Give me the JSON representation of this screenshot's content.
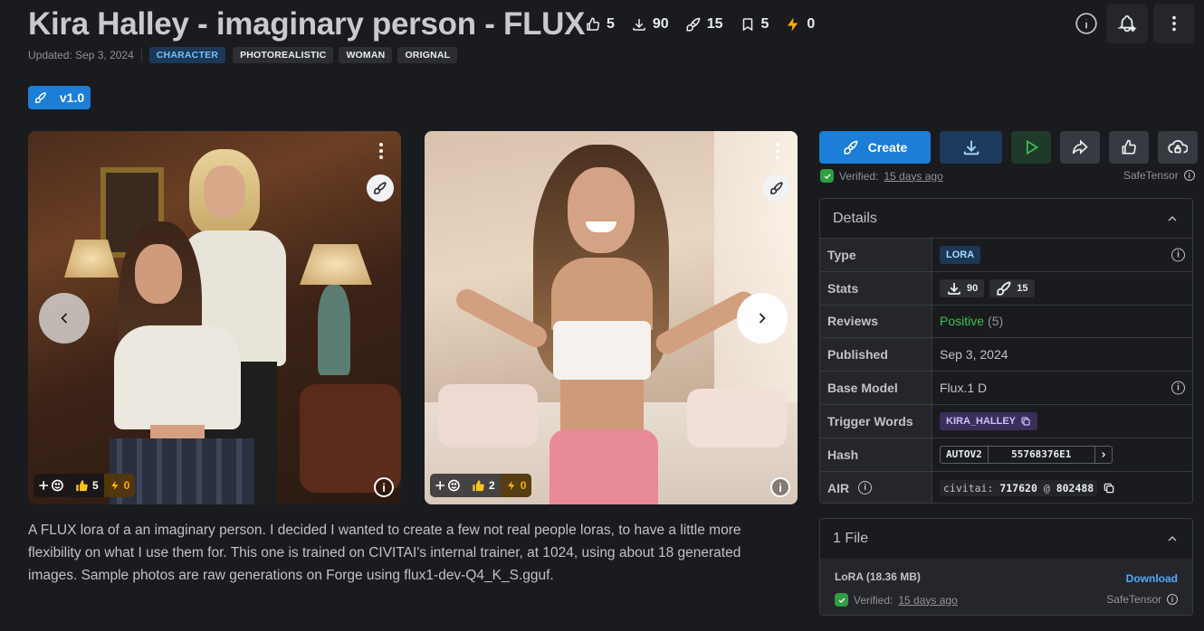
{
  "title": "Kira Halley - imaginary person - FLUX",
  "stats": {
    "likes": "5",
    "downloads": "90",
    "generations": "15",
    "bookmarks": "5",
    "buzz": "0"
  },
  "meta": {
    "updated": "Updated: Sep 3, 2024",
    "tags": [
      "CHARACTER",
      "PHOTOREALISTIC",
      "WOMAN",
      "ORIGNAL"
    ]
  },
  "version": {
    "label": "v1.0"
  },
  "images": [
    {
      "reactions": "5",
      "buzz": "0"
    },
    {
      "reactions": "2",
      "buzz": "0"
    }
  ],
  "description": "A FLUX lora of a an imaginary person. I decided I wanted to create a few not real people loras, to have a little more flexibility on what I use them for. This one is trained on CIVITAI's internal trainer, at 1024, using about 18 generated images. Sample photos are raw generations on Forge using flux1-dev-Q4_K_S.gguf.",
  "actions": {
    "create": "Create"
  },
  "verified": {
    "prefix": "Verified:",
    "when": "15 days ago",
    "format": "SafeTensor"
  },
  "details": {
    "heading": "Details",
    "labels": {
      "type": "Type",
      "stats": "Stats",
      "reviews": "Reviews",
      "published": "Published",
      "base_model": "Base Model",
      "trigger": "Trigger Words",
      "hash": "Hash",
      "air": "AIR"
    },
    "type": "LORA",
    "stats_downloads": "90",
    "stats_generations": "15",
    "reviews_sentiment": "Positive",
    "reviews_count": "(5)",
    "published": "Sep 3, 2024",
    "base_model": "Flux.1 D",
    "trigger_word": "KIRA_HALLEY",
    "hash_type": "AUTOV2",
    "hash_value": "55768376E1",
    "air_prefix": "civitai:",
    "air_model": "717620",
    "air_at": "@",
    "air_version": "802488"
  },
  "files": {
    "heading": "1 File",
    "name": "LoRA (18.36 MB)",
    "download": "Download",
    "verified_prefix": "Verified:",
    "verified_when": "15 days ago",
    "format": "SafeTensor"
  },
  "colors": {
    "accent": "#1c7ed6",
    "positive": "#40c057",
    "bolt": "#fab005"
  }
}
